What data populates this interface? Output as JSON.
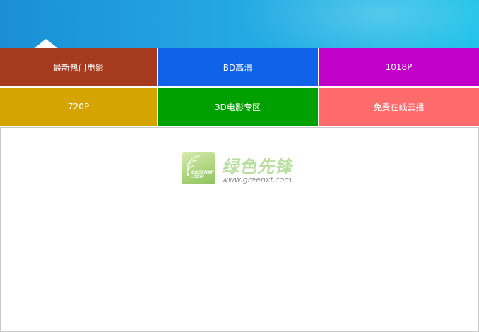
{
  "tiles": [
    {
      "label": "最新热门电影",
      "color": "#a63a1f"
    },
    {
      "label": "BD高清",
      "color": "#1063e8"
    },
    {
      "label": "1018P",
      "color": "#c100c9"
    },
    {
      "label": "720P",
      "color": "#d6a400"
    },
    {
      "label": "3D电影专区",
      "color": "#00a000"
    },
    {
      "label": "免费在线云播",
      "color": "#ff6b6b"
    }
  ],
  "watermark": {
    "badge_text_1": "GREENXF",
    "badge_text_2": ".COM",
    "title": "绿色先锋",
    "site": "www.greenxf.com"
  },
  "colors": {
    "banner_start": "#1a8fd6",
    "banner_end": "#18c0e8"
  }
}
